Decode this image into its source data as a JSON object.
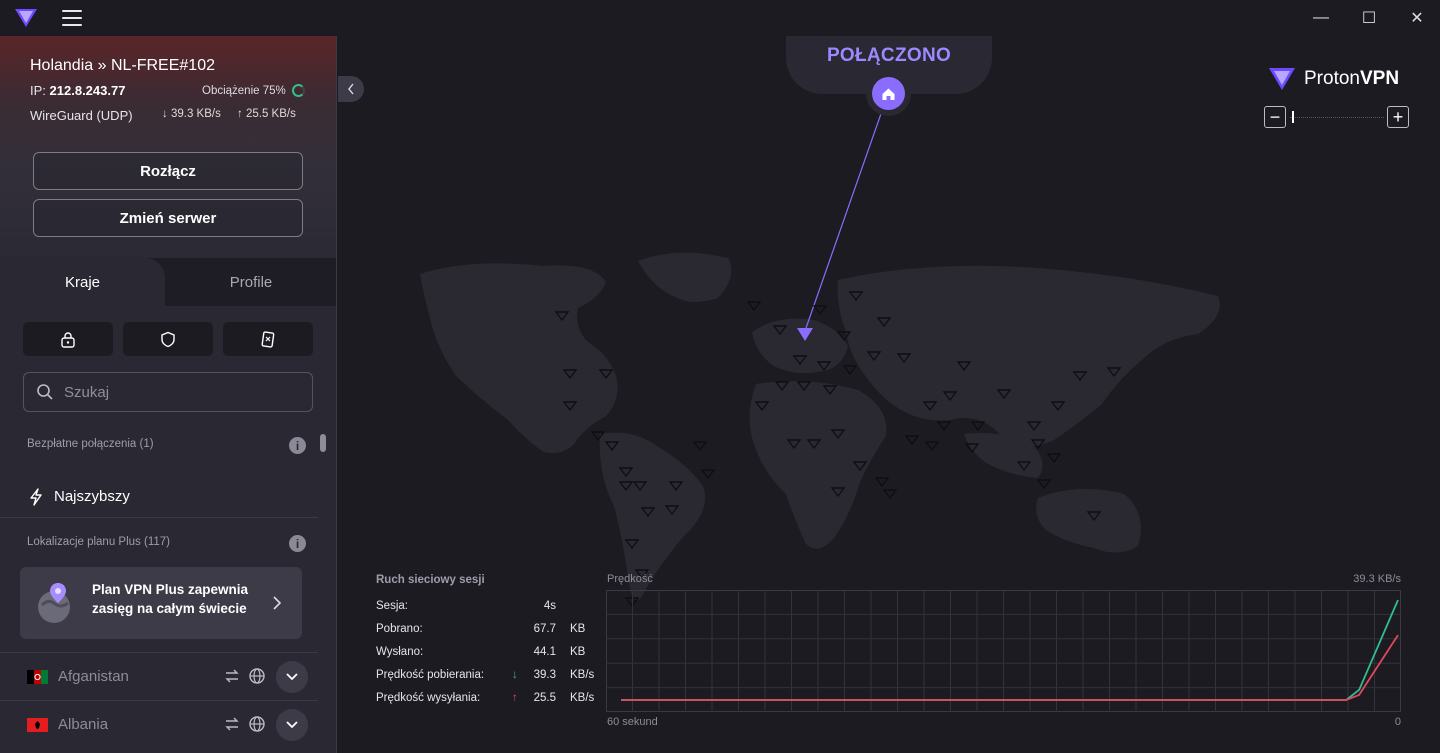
{
  "app": {
    "name": "Proton VPN"
  },
  "titlebar": {
    "minimize": "—",
    "maximize": "☐",
    "close": "✕"
  },
  "connection": {
    "title": "Holandia » NL-FREE#102",
    "ip_label": "IP:",
    "ip": "212.8.243.77",
    "load_label": "Obciążenie 75%",
    "load_fraction": 0.75,
    "protocol": "WireGuard (UDP)",
    "down_speed": "39.3 KB/s",
    "up_speed": "25.5 KB/s",
    "disconnect_label": "Rozłącz",
    "change_server_label": "Zmień serwer",
    "status": "POŁĄCZONO"
  },
  "tabs": [
    {
      "label": "Kraje",
      "active": true
    },
    {
      "label": "Profile",
      "active": false
    }
  ],
  "search": {
    "placeholder": "Szukaj",
    "value": ""
  },
  "sections": {
    "free": "Bezpłatne połączenia (1)",
    "fastest": "Najszybszy",
    "plus": "Lokalizacje planu Plus (117)"
  },
  "promo": {
    "line1": "Plan VPN Plus zapewnia",
    "line2": "zasięg na całym świecie"
  },
  "countries": [
    {
      "name": "Afganistan"
    },
    {
      "name": "Albania"
    }
  ],
  "brand": {
    "proton": "Proton",
    "vpn": "VPN"
  },
  "stats": {
    "header": "Ruch sieciowy sesji",
    "rows": [
      {
        "label": "Sesja:",
        "value": "4s",
        "unit": ""
      },
      {
        "label": "Pobrano:",
        "value": "67.7",
        "unit": "KB"
      },
      {
        "label": "Wysłano:",
        "value": "44.1",
        "unit": "KB"
      },
      {
        "label": "Prędkość pobierania:",
        "value": "39.3",
        "unit": "KB/s"
      },
      {
        "label": "Prędkość wysyłania:",
        "value": "25.5",
        "unit": "KB/s"
      }
    ]
  },
  "chart_data": {
    "type": "line",
    "title": "Prędkość",
    "max_label": "39.3  KB/s",
    "x_left_label": "60 sekund",
    "x_right_label": "0",
    "xlim": [
      60,
      0
    ],
    "ylim": [
      0,
      39.3
    ],
    "series": [
      {
        "color": "#2fbf8c",
        "x": [
          60,
          4,
          3,
          0
        ],
        "y": [
          0,
          0,
          4,
          39.3
        ]
      },
      {
        "color": "#e0485e",
        "x": [
          60,
          4,
          3,
          0
        ],
        "y": [
          0,
          0,
          2,
          25.5
        ]
      }
    ]
  },
  "colors": {
    "accent": "#8a6cff",
    "status": "#9c88ff",
    "download": "#2fbf8c",
    "upload": "#e0485e"
  }
}
